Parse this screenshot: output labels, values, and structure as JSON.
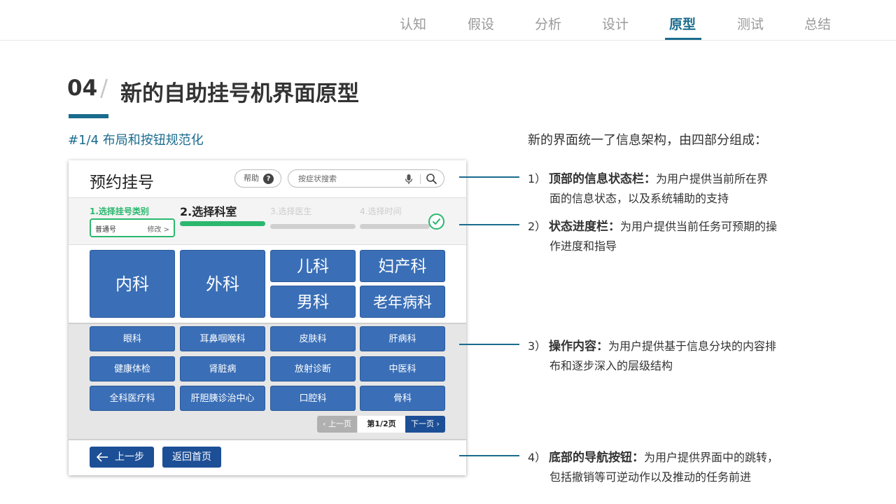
{
  "nav": {
    "items": [
      {
        "label": "认知"
      },
      {
        "label": "假设"
      },
      {
        "label": "分析"
      },
      {
        "label": "设计"
      },
      {
        "label": "原型",
        "active": true
      },
      {
        "label": "测试"
      },
      {
        "label": "总结"
      }
    ],
    "accent_color": "#1a6c8e"
  },
  "heading": {
    "number": "04",
    "slash": "/",
    "title": "新的自助挂号机界面原型",
    "subtitle": "#1/4 布局和按钮规范化"
  },
  "mock": {
    "title": "预约挂号",
    "help_label": "帮助",
    "help_icon": "?",
    "search_placeholder": "按症状搜索",
    "steps": [
      {
        "label": "1.选择挂号类别",
        "state": "done",
        "selected_value": "普通号",
        "modify_label": "修改 >"
      },
      {
        "label": "2.选择科室",
        "state": "current"
      },
      {
        "label": "3.选择医生",
        "state": "todo"
      },
      {
        "label": "4.选择时间",
        "state": "todo"
      }
    ],
    "big_departments": [
      "内科",
      "外科",
      "儿科",
      "妇产科",
      "男科",
      "老年病科"
    ],
    "small_departments": [
      "眼科",
      "耳鼻咽喉科",
      "皮肤科",
      "肝病科",
      "健康体检",
      "肾脏病",
      "放射诊断",
      "中医科",
      "全科医疗科",
      "肝胆胰诊治中心",
      "口腔科",
      "骨科"
    ],
    "pager": {
      "prev": "上一页",
      "current": "第1/2页",
      "next": "下一页"
    },
    "back_label": "上一步",
    "home_label": "返回首页",
    "colors": {
      "button_blue": "#3a6fb7",
      "nav_dark_blue": "#1d4f96",
      "progress_green": "#2bb86e"
    }
  },
  "description": {
    "intro": "新的界面统一了信息架构，由四部分组成：",
    "items": [
      {
        "num": "1）",
        "title": "顶部的信息状态栏：",
        "line1": "为用户提供当前所在界",
        "line2": "面的信息状态，以及系统辅助的支持"
      },
      {
        "num": "2）",
        "title": "状态进度栏：",
        "line1": "为用户提供当前任务可预期的操",
        "line2": "作进度和指导"
      },
      {
        "num": "3）",
        "title": "操作内容：",
        "line1": "为用户提供基于信息分块的内容排",
        "line2": "布和逐步深入的层级结构"
      },
      {
        "num": "4）",
        "title": "底部的导航按钮：",
        "line1": "为用户提供界面中的跳转，",
        "line2": "包括撤销等可逆动作以及推动的任务前进"
      }
    ]
  }
}
